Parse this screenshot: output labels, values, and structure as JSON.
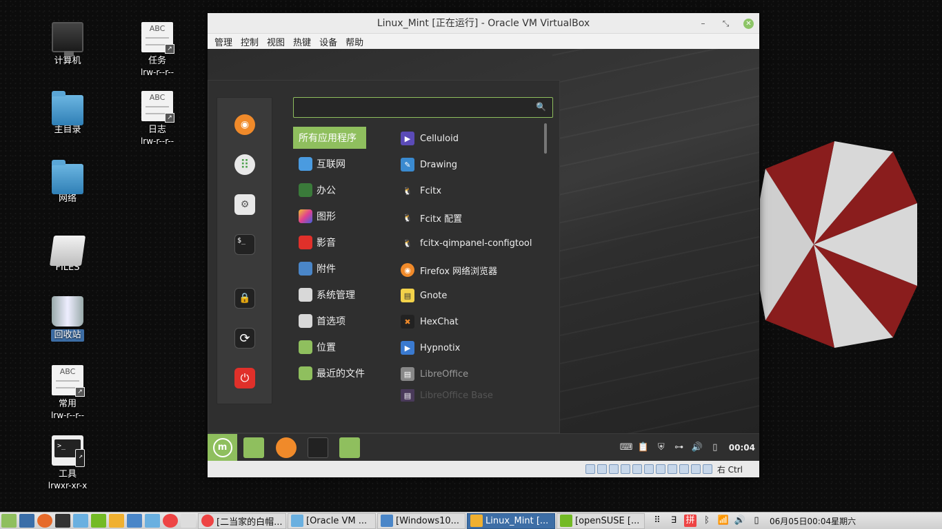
{
  "desktop": {
    "icons": [
      {
        "label": "计算机",
        "sub": ""
      },
      {
        "label": "主目录",
        "sub": ""
      },
      {
        "label": "网络",
        "sub": ""
      },
      {
        "label": "FILES",
        "sub": ""
      },
      {
        "label": "回收站",
        "sub": ""
      },
      {
        "label": "常用",
        "sub": "lrw-r--r--"
      },
      {
        "label": "工具",
        "sub": "lrwxr-xr-x"
      },
      {
        "label": "任务",
        "sub": "lrw-r--r--"
      },
      {
        "label": "日志",
        "sub": "lrw-r--r--"
      }
    ],
    "doc_icon_text": "ABC",
    "term_icon_text": ">_"
  },
  "vbox": {
    "title": "Linux_Mint [正在运行] - Oracle VM VirtualBox",
    "menu": [
      "管理",
      "控制",
      "视图",
      "热键",
      "设备",
      "帮助"
    ],
    "status_host_key": "右 Ctrl"
  },
  "mint_menu": {
    "search": {
      "value": "",
      "placeholder": ""
    },
    "categories": [
      {
        "label": "所有应用程序",
        "color": "#8fbf5e"
      },
      {
        "label": "互联网",
        "color": "#4a9be0"
      },
      {
        "label": "办公",
        "color": "#3a7a3a"
      },
      {
        "label": "图形",
        "color": "#c94fd0"
      },
      {
        "label": "影音",
        "color": "#e0302a"
      },
      {
        "label": "附件",
        "color": "#4a86c8"
      },
      {
        "label": "系统管理",
        "color": "#d8d8d8"
      },
      {
        "label": "首选项",
        "color": "#d8d8d8"
      },
      {
        "label": "位置",
        "color": "#8fbf5e"
      },
      {
        "label": "最近的文件",
        "color": "#8fbf5e"
      }
    ],
    "apps": [
      {
        "label": "Celluloid",
        "color": "#5b4bb7",
        "glyph": "▶"
      },
      {
        "label": "Drawing",
        "color": "#3a8ad0",
        "glyph": "✎"
      },
      {
        "label": "Fcitx",
        "color": "#2b2b2b",
        "glyph": "🐧"
      },
      {
        "label": "Fcitx 配置",
        "color": "#2b2b2b",
        "glyph": "🐧"
      },
      {
        "label": "fcitx-qimpanel-configtool",
        "color": "#2b2b2b",
        "glyph": "🐧"
      },
      {
        "label": "Firefox 网络浏览器",
        "color": "#f08a2a",
        "glyph": "◉"
      },
      {
        "label": "Gnote",
        "color": "#f2d24a",
        "glyph": "▤"
      },
      {
        "label": "HexChat",
        "color": "#222222",
        "glyph": "✖"
      },
      {
        "label": "Hypnotix",
        "color": "#3a7ad0",
        "glyph": "▶"
      },
      {
        "label": "LibreOffice",
        "color": "#888888",
        "glyph": "▤"
      },
      {
        "label": "LibreOffice Base",
        "color": "#6a4a7a",
        "glyph": "▤"
      }
    ]
  },
  "guest_panel": {
    "clock": "00:04"
  },
  "taskbar": {
    "tasks": [
      {
        "label": "[二当家的白帽...",
        "color": "#e44",
        "active": false
      },
      {
        "label": "[Oracle VM ...",
        "color": "#6ab0e0",
        "active": false
      },
      {
        "label": "[Windows10...",
        "color": "#4a86c8",
        "active": false
      },
      {
        "label": "Linux_Mint [...",
        "color": "#f0b030",
        "active": true
      },
      {
        "label": "[openSUSE [...",
        "color": "#73ba25",
        "active": false
      }
    ],
    "clock": "06月05日00:04星期六",
    "ime_label": "拼"
  }
}
